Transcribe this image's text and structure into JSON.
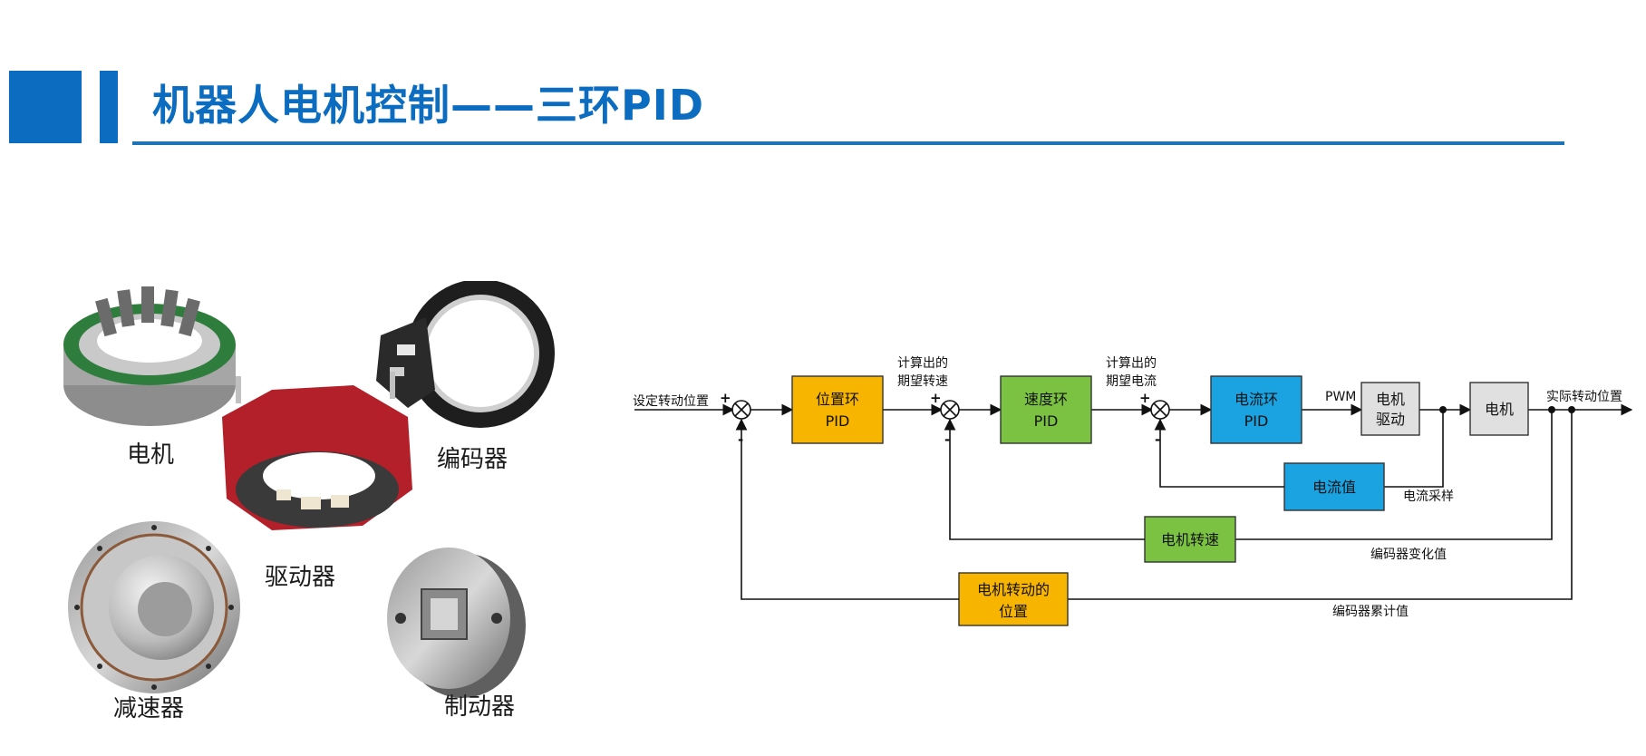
{
  "header": {
    "title": "机器人电机控制——三环PID",
    "accent_color": "#0b6cc0"
  },
  "components": {
    "motor_label": "电机",
    "encoder_label": "编码器",
    "driver_label": "驱动器",
    "reducer_label": "减速器",
    "brake_label": "制动器"
  },
  "diagram": {
    "input_label": "设定转动位置",
    "blocks": {
      "position_pid": [
        "位置环",
        "PID"
      ],
      "speed_pid": [
        "速度环",
        "PID"
      ],
      "current_pid": [
        "电流环",
        "PID"
      ],
      "motor_drive": [
        "电机",
        "驱动"
      ],
      "motor": "电机",
      "current_value": "电流值",
      "motor_speed": "电机转速",
      "motor_position": [
        "电机转动的",
        "位置"
      ]
    },
    "labels": {
      "desired_speed": [
        "计算出的",
        "期望转速"
      ],
      "desired_current": [
        "计算出的",
        "期望电流"
      ],
      "pwm": "PWM",
      "output": "实际转动位置",
      "current_sampling": "电流采样",
      "encoder_delta": "编码器变化值",
      "encoder_total": "编码器累计值"
    },
    "signs": {
      "plus": "+",
      "minus": "-"
    },
    "colors": {
      "position": "#f7b500",
      "speed": "#7cc242",
      "current": "#1aa3e0",
      "grey": "#e0e0e0"
    }
  }
}
